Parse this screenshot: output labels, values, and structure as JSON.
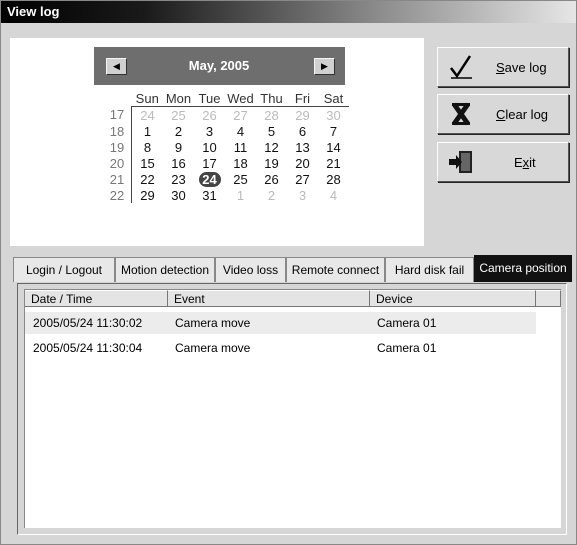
{
  "window": {
    "title": "View log"
  },
  "calendar": {
    "month_label": "May, 2005",
    "prev_icon": "arrow-left-icon",
    "next_icon": "arrow-right-icon",
    "days_of_week": [
      "Sun",
      "Mon",
      "Tue",
      "Wed",
      "Thu",
      "Fri",
      "Sat"
    ],
    "weeks": [
      {
        "num": "17",
        "days": [
          "24",
          "25",
          "26",
          "27",
          "28",
          "29",
          "30"
        ]
      },
      {
        "num": "18",
        "days": [
          "1",
          "2",
          "3",
          "4",
          "5",
          "6",
          "7"
        ]
      },
      {
        "num": "19",
        "days": [
          "8",
          "9",
          "10",
          "11",
          "12",
          "13",
          "14"
        ]
      },
      {
        "num": "20",
        "days": [
          "15",
          "16",
          "17",
          "18",
          "19",
          "20",
          "21"
        ]
      },
      {
        "num": "21",
        "days": [
          "22",
          "23",
          "24",
          "25",
          "26",
          "27",
          "28"
        ]
      },
      {
        "num": "22",
        "days": [
          "29",
          "30",
          "31",
          "1",
          "2",
          "3",
          "4"
        ]
      }
    ],
    "selected_day": "24"
  },
  "buttons": {
    "save": {
      "prefix": "",
      "accel": "S",
      "suffix": "ave log",
      "icon": "checkmark-pen-icon"
    },
    "clear": {
      "prefix": "",
      "accel": "C",
      "suffix": "lear log",
      "icon": "clear-x-icon"
    },
    "exit": {
      "prefix": "E",
      "accel": "x",
      "suffix": "it",
      "icon": "exit-door-icon"
    }
  },
  "tabs": [
    {
      "label": "Login / Logout",
      "active": false
    },
    {
      "label": "Motion detection",
      "active": false
    },
    {
      "label": "Video loss",
      "active": false
    },
    {
      "label": "Remote connect",
      "active": false
    },
    {
      "label": "Hard disk fail",
      "active": false
    },
    {
      "label": "Camera position",
      "active": true
    }
  ],
  "log": {
    "columns": [
      "Date / Time",
      "Event",
      "Device"
    ],
    "rows": [
      {
        "datetime": "2005/05/24 11:30:02",
        "event": "Camera move",
        "device": "Camera 01"
      },
      {
        "datetime": "2005/05/24 11:30:04",
        "event": "Camera move",
        "device": "Camera 01"
      }
    ]
  },
  "colors": {
    "accent": "#444444",
    "tab_active": "#111111"
  }
}
